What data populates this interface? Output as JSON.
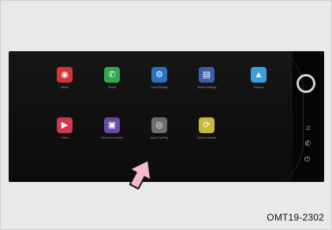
{
  "figure_code": "OMT19-2302",
  "apps": [
    {
      "label": "Media",
      "icon": "disc-icon",
      "color": "#d23438"
    },
    {
      "label": "Phone",
      "icon": "phone-icon",
      "color": "#2fa84f"
    },
    {
      "label": "Local Settings",
      "icon": "gear-icon",
      "color": "#2d6fc0"
    },
    {
      "label": "Vehicle Settings",
      "icon": "car-icon",
      "color": "#3d5ea6"
    },
    {
      "label": "Pictures",
      "icon": "picture-icon",
      "color": "#3a9ee0"
    },
    {
      "label": "Video",
      "icon": "play-icon",
      "color": "#d0374a"
    },
    {
      "label": "Electronic manual",
      "icon": "manual-icon",
      "color": "#6a4aa8"
    },
    {
      "label": "Apple CarPlay",
      "icon": "carplay-icon",
      "color": "#6e6e6e"
    },
    {
      "label": "System Update",
      "icon": "update-icon",
      "color": "#c9b93b"
    }
  ],
  "side_icons": [
    "home-ring-icon",
    "music-note-icon",
    "phone-icon",
    "power-icon"
  ],
  "colors": {
    "frame": "#e9e9e9",
    "screen": "#111111",
    "pointer_fill": "#f6b9c8",
    "pointer_stroke": "#111111"
  }
}
